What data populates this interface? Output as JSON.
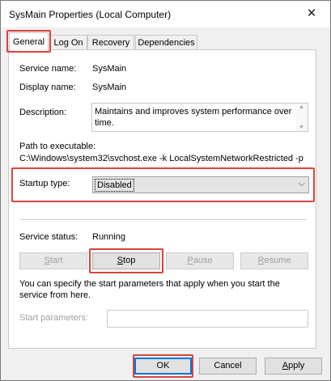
{
  "window": {
    "title": "SysMain Properties (Local Computer)",
    "close_glyph": "✕"
  },
  "tabs": [
    {
      "label": "General",
      "active": true
    },
    {
      "label": "Log On",
      "active": false
    },
    {
      "label": "Recovery",
      "active": false
    },
    {
      "label": "Dependencies",
      "active": false
    }
  ],
  "general": {
    "service_name_label": "Service name:",
    "service_name_value": "SysMain",
    "display_name_label": "Display name:",
    "display_name_value": "SysMain",
    "description_label": "Description:",
    "description_value": "Maintains and improves system performance over time.",
    "path_label": "Path to executable:",
    "path_value": "C:\\Windows\\system32\\svchost.exe -k LocalSystemNetworkRestricted -p",
    "startup_type_label": "Startup type:",
    "startup_type_value": "Disabled",
    "service_status_label": "Service status:",
    "service_status_value": "Running",
    "buttons": {
      "start": "Start",
      "stop": "Stop",
      "pause": "Pause",
      "resume": "Resume"
    },
    "params_help": "You can specify the start parameters that apply when you start the service from here.",
    "start_params_label": "Start parameters:",
    "start_params_value": ""
  },
  "footer": {
    "ok": "OK",
    "cancel": "Cancel",
    "apply": "Apply"
  },
  "highlight_color": "#d9443b"
}
